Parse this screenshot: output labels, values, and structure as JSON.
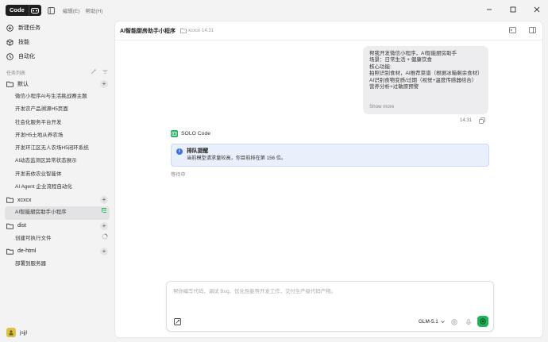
{
  "titlebar": {
    "mode_label": "Code",
    "menu": [
      "编辑(E)",
      "帮助(H)"
    ]
  },
  "sidebar": {
    "nav": [
      {
        "label": "新建任务",
        "icon": "plus-circle-icon"
      },
      {
        "label": "技能",
        "icon": "cube-icon"
      },
      {
        "label": "自动化",
        "icon": "clock-icon"
      }
    ],
    "section_label": "任务列表",
    "groups": [
      {
        "name": "默认",
        "tasks": [
          "微信小程序AI与生活挑战赛主题",
          "开发农产品溯源H5页面",
          "社会化服务平台开发",
          "开发H5土地从养农场",
          "开发环江区无人农场H5闭环系统",
          "AI动态监测区异常状态展示",
          "开发若依农业智能体",
          "AI Agent 企业流程自动化"
        ]
      },
      {
        "name": "xcxcx",
        "tasks": [
          "AI智能厨房助手小程序"
        ]
      },
      {
        "name": "dist",
        "tasks": [
          "创建可执行文件"
        ]
      },
      {
        "name": "de-html",
        "tasks": [
          "部署到服务器"
        ]
      }
    ],
    "user": {
      "name": "jsjjl"
    }
  },
  "main": {
    "title": "AI智能厨房助手小程序",
    "project": "xcxcx",
    "time": "14:31",
    "meta_separator": " · ",
    "user_message": {
      "lines": [
        "帮我开发微信小程序，AI智能厨房助手",
        "场景：日常生活 + 健康饮食",
        "核心功能:",
        "拍照识别食材，AI推荐菜谱（根据冰箱剩余食材）",
        "AI识别食物变质/过期（视觉+温度传感器结合）",
        "营养分析+过敏原预警"
      ],
      "show_more": "Show more",
      "time": "14:31"
    },
    "agent_name": "SOLO Code",
    "notice": {
      "title": "排队提醒",
      "text": "当前模型请求量较高，你目前排在第 156 位。"
    },
    "waiting": "等待中",
    "composer": {
      "placeholder": "帮你编写代码、调试 Bug、优化性能等开发工作，交付生产级代码产物。",
      "model": "GLM-5.1"
    }
  },
  "colors": {
    "accent_green": "#1fb45a",
    "notice_blue": "#3b73e6",
    "avatar_yellow": "#d9c24c"
  }
}
